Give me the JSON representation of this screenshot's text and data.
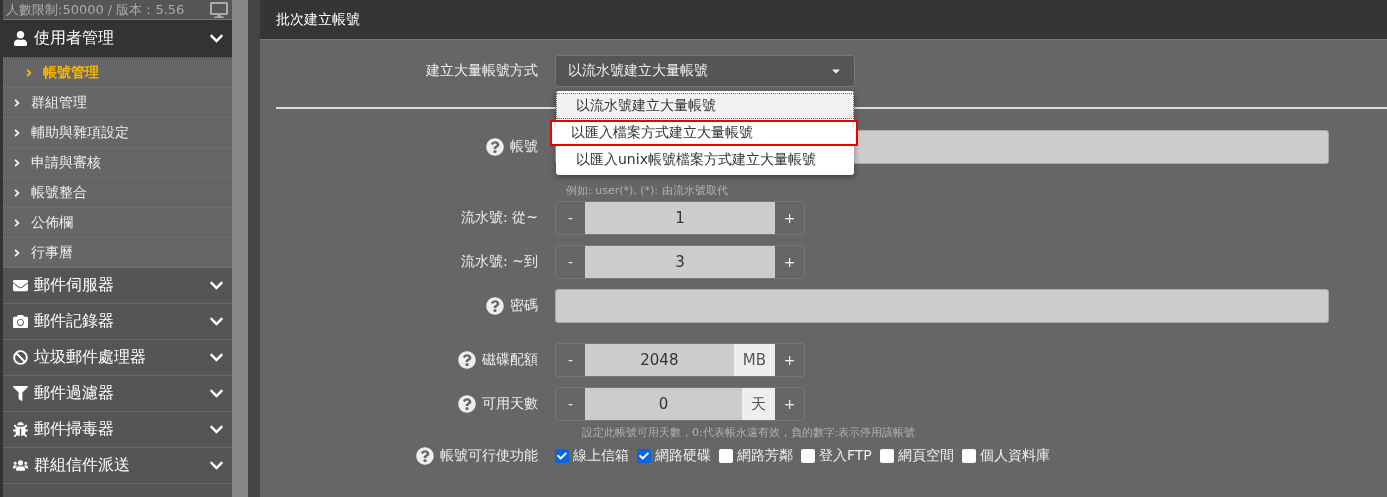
{
  "sidebar": {
    "info": "人數限制:50000 / 版本：5.56",
    "groups": [
      {
        "label": "使用者管理",
        "expanded": true,
        "items": [
          {
            "label": "帳號管理",
            "selected": true
          },
          {
            "label": "群組管理",
            "selected": false
          },
          {
            "label": "輔助與雜項設定",
            "selected": false
          },
          {
            "label": "申請與審核",
            "selected": false
          },
          {
            "label": "帳號整合",
            "selected": false
          },
          {
            "label": "公佈欄",
            "selected": false
          },
          {
            "label": "行事曆",
            "selected": false
          }
        ]
      },
      {
        "label": "郵件伺服器",
        "expanded": false
      },
      {
        "label": "郵件記錄器",
        "expanded": false
      },
      {
        "label": "垃圾郵件處理器",
        "expanded": false
      },
      {
        "label": "郵件過濾器",
        "expanded": false
      },
      {
        "label": "郵件掃毒器",
        "expanded": false
      },
      {
        "label": "群組信件派送",
        "expanded": false
      }
    ]
  },
  "panel": {
    "title": "批次建立帳號"
  },
  "method": {
    "label": "建立大量帳號方式",
    "value": "以流水號建立大量帳號",
    "open": true,
    "options": [
      {
        "label": "以流水號建立大量帳號",
        "selected": true,
        "highlighted": false
      },
      {
        "label": "以匯入檔案方式建立大量帳號",
        "selected": false,
        "highlighted": true
      },
      {
        "label": "以匯入unix帳號檔案方式建立大量帳號",
        "selected": false,
        "highlighted": false
      }
    ]
  },
  "fields": [
    {
      "kind": "text",
      "label": "帳號",
      "help": true,
      "hint": "例如: user(*), (*): 由流水號取代"
    },
    {
      "kind": "stepper",
      "label": "流水號: 從~",
      "help": false,
      "minus": "-",
      "value": "1",
      "plus": "+"
    },
    {
      "kind": "stepper",
      "label": "流水號: ~到",
      "help": false,
      "minus": "-",
      "value": "3",
      "plus": "+"
    },
    {
      "kind": "text",
      "label": "密碼",
      "help": true
    },
    {
      "kind": "stepper",
      "label": "磁碟配額",
      "help": true,
      "minus": "-",
      "value": "2048",
      "unit": "MB",
      "plus": "+"
    },
    {
      "kind": "stepper",
      "label": "可用天數",
      "help": true,
      "minus": "-",
      "value": "0",
      "unit": "天",
      "plus": "+",
      "hint": "設定此帳號可用天數，0:代表帳永遠有效，負的數字:表示停用該帳號"
    },
    {
      "kind": "checks",
      "label": "帳號可行使功能",
      "help": true,
      "options": [
        {
          "label": "線上信箱",
          "checked": true
        },
        {
          "label": "網路硬碟",
          "checked": true
        },
        {
          "label": "網路芳鄰",
          "checked": false
        },
        {
          "label": "登入FTP",
          "checked": false
        },
        {
          "label": "網頁空間",
          "checked": false
        },
        {
          "label": "個人資料庫",
          "checked": false
        }
      ]
    }
  ]
}
